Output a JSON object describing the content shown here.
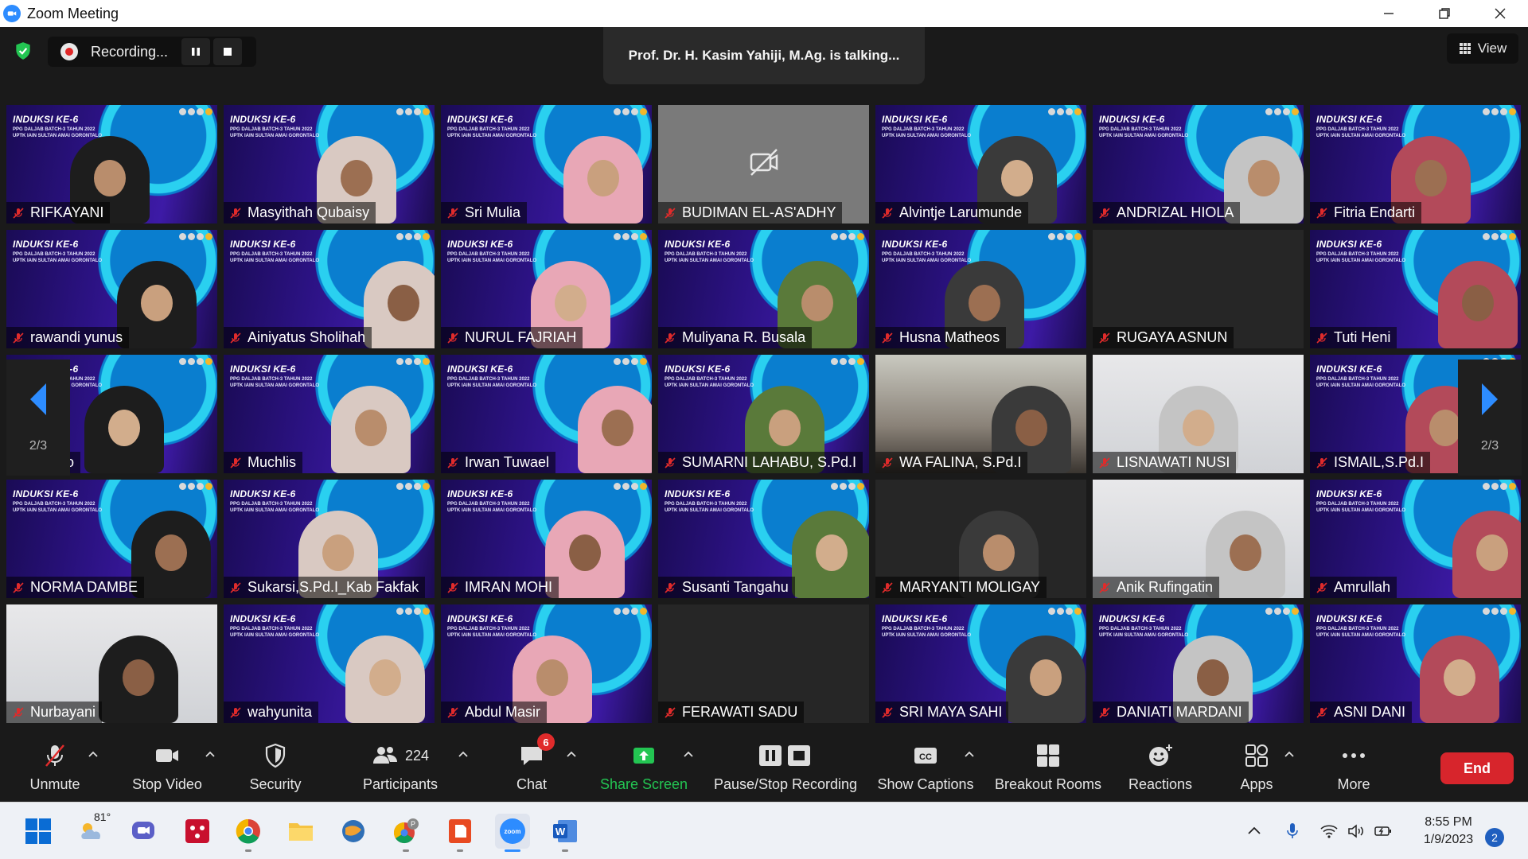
{
  "window": {
    "title": "Zoom Meeting"
  },
  "topbar": {
    "recording_label": "Recording...",
    "talking_text": "Prof. Dr. H. Kasim Yahiji, M.Ag. is talking...",
    "view_label": "View"
  },
  "brand": {
    "title": "INDUKSI KE-6",
    "line1": "PPG DALJAB BATCH-3 TAHUN 2022",
    "line2": "UPTK IAIN SULTAN AMAI GORONTALO"
  },
  "pagination": {
    "left_label": "2/3",
    "right_label": "2/3"
  },
  "participants": [
    {
      "name": "RIFKAYANI",
      "bg": "brand"
    },
    {
      "name": "Masyithah Qubaisy",
      "bg": "brand"
    },
    {
      "name": "Sri Mulia",
      "bg": "brand"
    },
    {
      "name": "BUDIMAN EL-AS'ADHY",
      "bg": "grey"
    },
    {
      "name": "Alvintje Larumunde",
      "bg": "brand"
    },
    {
      "name": "ANDRIZAL HIOLA",
      "bg": "brand"
    },
    {
      "name": "Fitria Endarti",
      "bg": "brand"
    },
    {
      "name": "rawandi yunus",
      "bg": "brand"
    },
    {
      "name": "Ainiyatus Sholihah",
      "bg": "brand"
    },
    {
      "name": "NURUL FAJRIAH",
      "bg": "brand"
    },
    {
      "name": "Muliyana R. Busala",
      "bg": "brand"
    },
    {
      "name": "Husna Matheos",
      "bg": "brand"
    },
    {
      "name": "RUGAYA ASNUN",
      "bg": "dark"
    },
    {
      "name": "Tuti Heni",
      "bg": "brand"
    },
    {
      "name": "ugiarto",
      "bg": "brand"
    },
    {
      "name": "Muchlis",
      "bg": "brand"
    },
    {
      "name": "Irwan Tuwael",
      "bg": "brand"
    },
    {
      "name": "SUMARNI LAHABU, S.Pd.I",
      "bg": "brand"
    },
    {
      "name": "WA FALINA, S.Pd.I",
      "bg": "room"
    },
    {
      "name": "LISNAWATI NUSI",
      "bg": "light"
    },
    {
      "name": "ISMAIL,S.Pd.I",
      "bg": "brand"
    },
    {
      "name": "NORMA DAMBE",
      "bg": "brand"
    },
    {
      "name": "Sukarsi,S.Pd.I_Kab Fakfak",
      "bg": "brand"
    },
    {
      "name": "IMRAN MOHI",
      "bg": "brand"
    },
    {
      "name": "Susanti Tangahu",
      "bg": "brand"
    },
    {
      "name": "MARYANTI MOLIGAY",
      "bg": "dark"
    },
    {
      "name": "Anik Rufingatin",
      "bg": "light"
    },
    {
      "name": "Amrullah",
      "bg": "brand"
    },
    {
      "name": "Nurbayani",
      "bg": "light"
    },
    {
      "name": "wahyunita",
      "bg": "brand"
    },
    {
      "name": "Abdul Masir",
      "bg": "brand"
    },
    {
      "name": "FERAWATI SADU",
      "bg": "dark"
    },
    {
      "name": "SRI MAYA SAHI",
      "bg": "brand"
    },
    {
      "name": "DANIATI MARDANI",
      "bg": "brand"
    },
    {
      "name": "ASNI DANI",
      "bg": "brand"
    }
  ],
  "toolbar": {
    "unmute": "Unmute",
    "stop_video": "Stop Video",
    "security": "Security",
    "participants": "Participants",
    "participants_count": "224",
    "chat": "Chat",
    "chat_badge": "6",
    "share_screen": "Share Screen",
    "pause_stop_recording": "Pause/Stop Recording",
    "show_captions": "Show Captions",
    "breakout_rooms": "Breakout Rooms",
    "reactions": "Reactions",
    "apps": "Apps",
    "more": "More",
    "end": "End"
  },
  "taskbar": {
    "temperature": "81°",
    "time": "8:55 PM",
    "date": "1/9/2023",
    "notification_count": "2"
  },
  "colors": {
    "zoom_blue": "#2D8CFF",
    "share_green": "#23c552",
    "end_red": "#d7252c",
    "muted_red": "#e02b2b"
  }
}
